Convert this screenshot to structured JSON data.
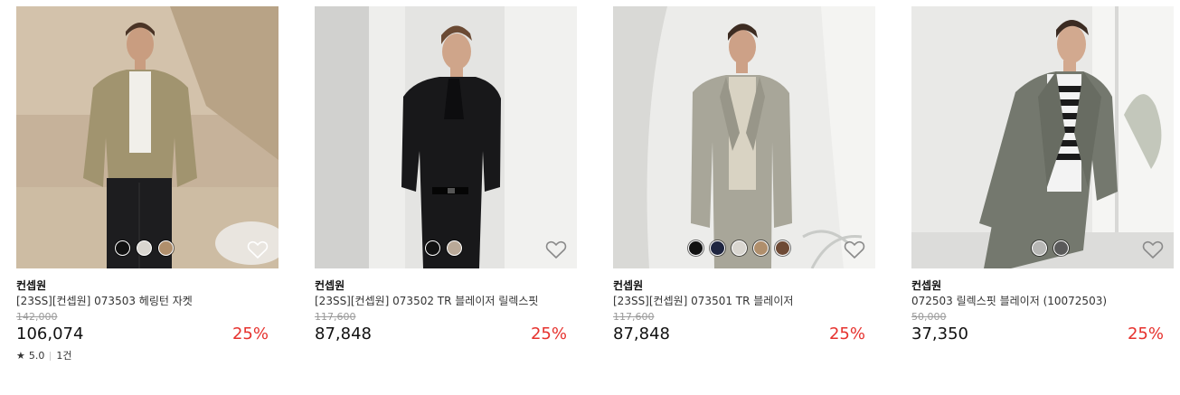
{
  "products": [
    {
      "brand": "컨셉원",
      "name": "[23SS][컨셉원] 073503 헤링턴 자켓",
      "original_price": "142,000",
      "price": "106,074",
      "discount": "25%",
      "rating": {
        "star": "★",
        "score": "5.0",
        "count": "1건"
      },
      "swatches": [
        "#111111",
        "#d9d6d0",
        "#b08f6c"
      ]
    },
    {
      "brand": "컨셉원",
      "name": "[23SS][컨셉원] 073502 TR 블레이저 릴렉스핏",
      "original_price": "117,600",
      "price": "87,848",
      "discount": "25%",
      "swatches": [
        "#111111",
        "#b9a998"
      ]
    },
    {
      "brand": "컨셉원",
      "name": "[23SS][컨셉원] 073501 TR 블레이저",
      "original_price": "117,600",
      "price": "87,848",
      "discount": "25%",
      "swatches": [
        "#111111",
        "#1e2540",
        "#d9d6d0",
        "#b08f6c",
        "#6e4a35"
      ]
    },
    {
      "brand": "컨셉원",
      "name": "072503 릴렉스핏 블레이저 (10072503)",
      "original_price": "50,000",
      "price": "37,350",
      "discount": "25%",
      "swatches": [
        "#b7b7b5",
        "#5a5a5a"
      ]
    }
  ],
  "colors": {
    "discount": "#e6312d",
    "original_price": "#9a9a9a"
  },
  "icons": {
    "wishlist": "heart-outline-icon",
    "rating": "star-icon"
  }
}
